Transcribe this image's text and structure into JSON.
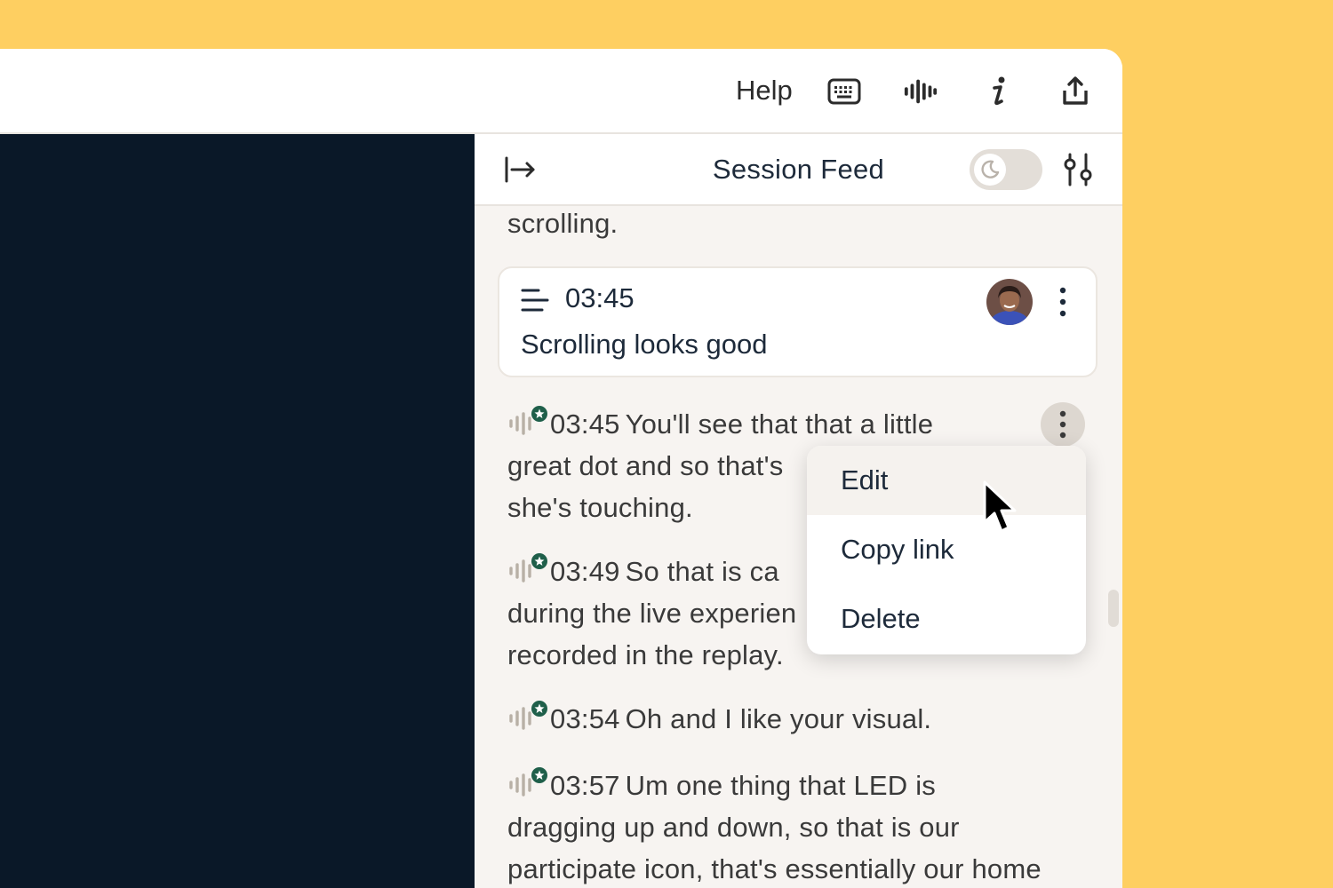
{
  "topbar": {
    "help_label": "Help",
    "icons": [
      "keyboard-icon",
      "audio-waveform-icon",
      "info-icon",
      "share-icon"
    ]
  },
  "panel": {
    "title": "Session Feed",
    "collapse_icon": "collapse-panel-icon",
    "theme_toggle_icon": "moon-icon",
    "filter_icon": "sliders-icon"
  },
  "feed": {
    "fragment": "scrolling.",
    "note": {
      "time": "03:45",
      "text": "Scrolling looks good"
    },
    "entries": [
      {
        "time": "03:45",
        "lines": [
          "You'll see that that a little",
          "great dot and so that's",
          "she's touching."
        ]
      },
      {
        "time": "03:49",
        "lines": [
          "So that is ca",
          "during the live experien",
          "recorded in the replay."
        ]
      },
      {
        "time": "03:54",
        "lines": [
          "Oh and I like your visual."
        ]
      },
      {
        "time": "03:57",
        "lines": [
          "Um one thing that LED is",
          "dragging up and down, so that is our",
          "participate icon, that's essentially our home"
        ]
      }
    ]
  },
  "menu": {
    "items": [
      "Edit",
      "Copy link",
      "Delete"
    ]
  },
  "colors": {
    "background": "#fecf61",
    "video": "#0a1828",
    "panel": "#f7f4f1",
    "badge": "#1f5f4a"
  }
}
